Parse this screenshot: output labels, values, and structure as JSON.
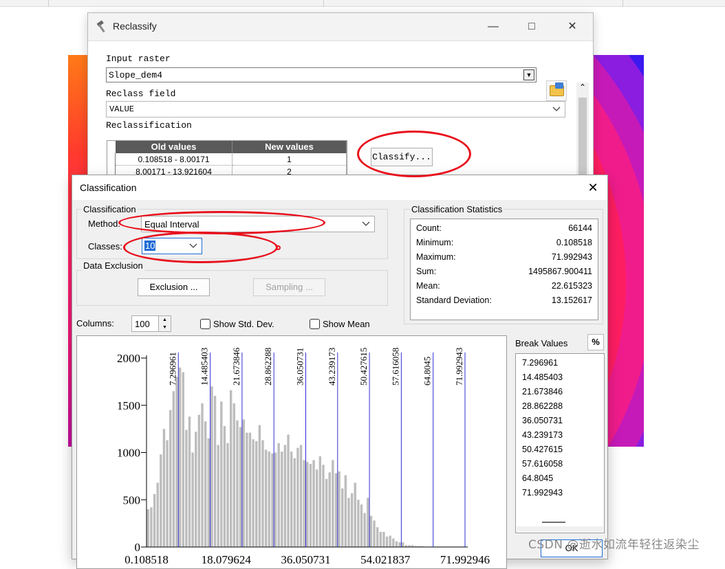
{
  "reclassify_window": {
    "title": "Reclassify",
    "input_raster_label": "Input raster",
    "input_raster_value": "Slope_dem4",
    "reclass_field_label": "Reclass field",
    "reclass_field_value": "VALUE",
    "reclassification_label": "Reclassification",
    "table": {
      "headers": [
        "Old values",
        "New values"
      ],
      "rows": [
        [
          "0.108518 - 8.00171",
          "1"
        ],
        [
          "8.00171 - 13.921604",
          "2"
        ]
      ]
    },
    "classify_button": "Classify..."
  },
  "classification_dialog": {
    "title": "Classification",
    "classification_group": "Classification",
    "method_label": "Method:",
    "method_value": "Equal Interval",
    "classes_label": "Classes:",
    "classes_value": "10",
    "data_exclusion_group": "Data Exclusion",
    "exclusion_button": "Exclusion ...",
    "sampling_button": "Sampling ...",
    "stats_group": "Classification Statistics",
    "stats": [
      {
        "label": "Count:",
        "value": "66144"
      },
      {
        "label": "Minimum:",
        "value": "0.108518"
      },
      {
        "label": "Maximum:",
        "value": "71.992943"
      },
      {
        "label": "Sum:",
        "value": "1495867.900411"
      },
      {
        "label": "Mean:",
        "value": "22.615323"
      },
      {
        "label": "Standard Deviation:",
        "value": "13.152617"
      }
    ],
    "columns_label": "Columns:",
    "columns_value": "100",
    "show_std_dev": "Show Std. Dev.",
    "show_mean": "Show Mean",
    "break_values_label": "Break Values",
    "percent_button": "%",
    "break_values": [
      "7.296961",
      "14.485403",
      "21.673846",
      "28.862288",
      "36.050731",
      "43.239173",
      "50.427615",
      "57.616058",
      "64.8045",
      "71.992943"
    ],
    "ok_button": "OK"
  },
  "chart_data": {
    "type": "bar",
    "x_range": [
      0.108518,
      71.992943
    ],
    "ylim": [
      0,
      2000
    ],
    "y_ticks": [
      "0",
      "500",
      "1000",
      "1500",
      "2000"
    ],
    "x_tick_labels": [
      "0.108518",
      "18.079624",
      "36.050731",
      "54.021837",
      "71.992946"
    ],
    "x_ticks_visible_text": [
      "0.108518",
      "18.079624",
      "36.050731",
      "54.021837",
      "71.992946"
    ],
    "break_lines": [
      7.296961,
      14.485403,
      21.673846,
      28.862288,
      36.050731,
      43.239173,
      50.427615,
      57.616058,
      64.8045,
      71.992943
    ],
    "values": [
      400,
      420,
      560,
      680,
      980,
      1250,
      1130,
      1450,
      1650,
      1800,
      1900,
      1850,
      1240,
      1380,
      1000,
      1220,
      1400,
      1520,
      1330,
      1150,
      1700,
      1600,
      1080,
      1540,
      1280,
      1100,
      1660,
      1520,
      1340,
      1270,
      1350,
      1210,
      1210,
      1140,
      1120,
      1290,
      1130,
      1030,
      1010,
      990,
      1000,
      1100,
      1010,
      1080,
      1190,
      1010,
      940,
      1050,
      1080,
      920,
      900,
      880,
      920,
      820,
      960,
      870,
      720,
      790,
      920,
      780,
      800,
      620,
      760,
      520,
      570,
      680,
      500,
      450,
      360,
      520,
      330,
      280,
      210,
      160,
      160,
      110,
      120,
      90,
      60,
      50,
      50,
      20,
      20,
      20,
      10,
      10,
      10,
      5,
      5,
      5,
      5,
      5,
      5,
      5,
      5,
      5,
      5,
      5,
      5,
      5
    ]
  },
  "watermark": "CSDN @逝水如流年轻往返染尘"
}
